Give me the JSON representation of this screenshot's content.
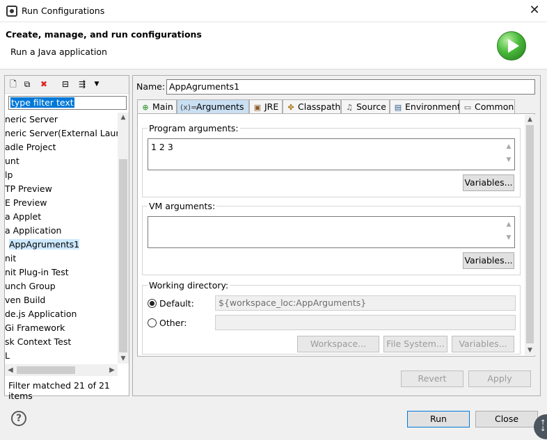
{
  "window": {
    "title": "Run Configurations"
  },
  "header": {
    "title": "Create, manage, and run configurations",
    "subtitle": "Run a Java application"
  },
  "left": {
    "filter_placeholder": "type filter text",
    "items": [
      "neric Server",
      "neric Server(External Launc",
      "adle Project",
      "unt",
      "lp",
      "TP Preview",
      "E Preview",
      "a Applet",
      "a Application",
      "AppAgruments1",
      "nit",
      "nit Plug-in Test",
      "unch Group",
      "ven Build",
      "de.js Application",
      "Gi Framework",
      "sk Context Test",
      "L"
    ],
    "selected_index": 9,
    "status": "Filter matched 21 of 21 items"
  },
  "right": {
    "name_label": "Name:",
    "name_value": "AppAgruments1",
    "tabs": [
      {
        "label": "Main",
        "icon": "main-tab-icon"
      },
      {
        "label": "Arguments",
        "icon": "arguments-tab-icon"
      },
      {
        "label": "JRE",
        "icon": "jre-tab-icon"
      },
      {
        "label": "Classpath",
        "icon": "classpath-tab-icon"
      },
      {
        "label": "Source",
        "icon": "source-tab-icon"
      },
      {
        "label": "Environment",
        "icon": "environment-tab-icon"
      },
      {
        "label": "Common",
        "icon": "common-tab-icon"
      }
    ],
    "program_args": {
      "label": "Program arguments:",
      "value": "1 2 3",
      "variables_btn": "Variables..."
    },
    "vm_args": {
      "label": "VM arguments:",
      "value": "",
      "variables_btn": "Variables..."
    },
    "working_dir": {
      "label": "Working directory:",
      "default_label": "Default:",
      "default_value": "${workspace_loc:AppArguments}",
      "other_label": "Other:",
      "other_value": "",
      "workspace_btn": "Workspace...",
      "filesystem_btn": "File System...",
      "variables_btn": "Variables..."
    },
    "revert_btn": "Revert",
    "apply_btn": "Apply"
  },
  "footer": {
    "run_btn": "Run",
    "close_btn": "Close"
  }
}
